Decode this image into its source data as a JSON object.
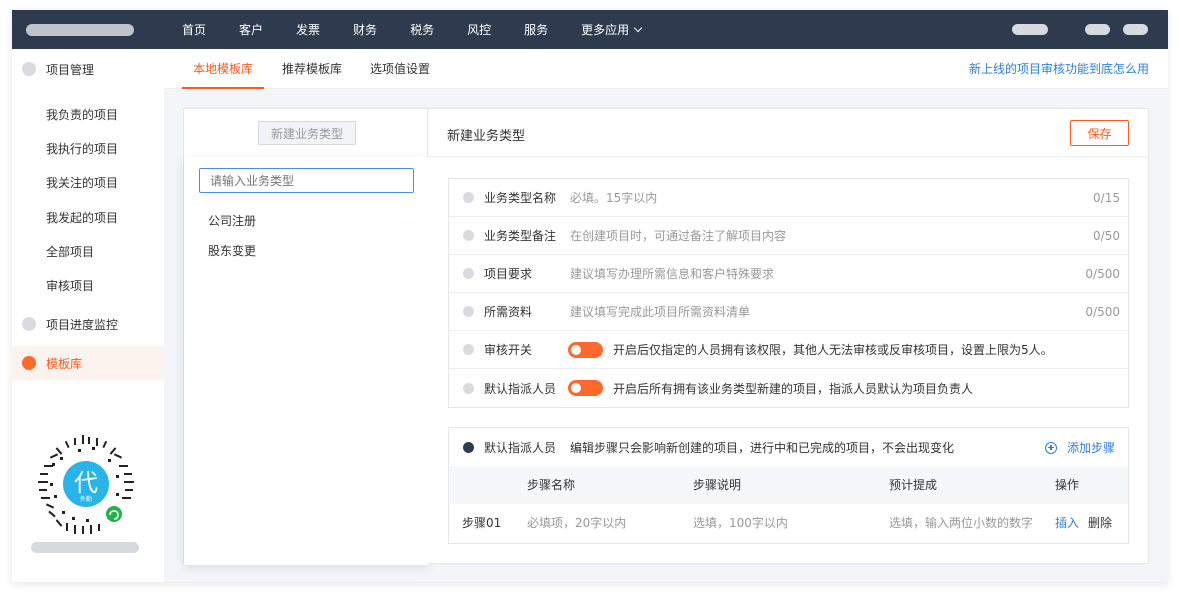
{
  "topbar": {
    "nav": [
      "首页",
      "客户",
      "发票",
      "财务",
      "税务",
      "风控",
      "服务"
    ],
    "more_label": "更多应用"
  },
  "sidebar": {
    "groups": [
      {
        "label": "项目管理",
        "active": false
      },
      {
        "label": "项目进度监控",
        "active": false
      },
      {
        "label": "模板库",
        "active": true
      }
    ],
    "sub_items": [
      "我负责的项目",
      "我执行的项目",
      "我关注的项目",
      "我发起的项目",
      "全部项目",
      "审核项目"
    ],
    "qr_center_text": "代",
    "qr_sub_text": "外勤"
  },
  "tabs": {
    "items": [
      "本地模板库",
      "推荐模板库",
      "选项值设置"
    ],
    "active_index": 0,
    "help_link": "新上线的项目审核功能到底怎么用"
  },
  "left_panel": {
    "new_button": "新建业务类型",
    "input_placeholder": "请输入业务类型",
    "types": [
      "公司注册",
      "股东变更"
    ]
  },
  "right_panel": {
    "title": "新建业务类型",
    "save_label": "保存",
    "fields": [
      {
        "label": "业务类型名称",
        "placeholder": "必填。15字以内",
        "count": "0/15"
      },
      {
        "label": "业务类型备注",
        "placeholder": "在创建项目时，可通过备注了解项目内容",
        "count": "0/50"
      },
      {
        "label": "项目要求",
        "placeholder": "建议填写办理所需信息和客户特殊要求",
        "count": "0/500"
      },
      {
        "label": "所需资料",
        "placeholder": "建议填写完成此项目所需资料清单",
        "count": "0/500"
      }
    ],
    "toggles": [
      {
        "label": "审核开关",
        "on": true,
        "desc": "开启后仅指定的人员拥有该权限，其他人无法审核或反审核项目，设置上限为5人。"
      },
      {
        "label": "默认指派人员",
        "on": true,
        "desc": "开启后所有拥有该业务类型新建的项目，指派人员默认为项目负责人"
      }
    ],
    "steps": {
      "label": "默认指派人员",
      "note": "编辑步骤只会影响新创建的项目，进行中和已完成的项目，不会出现变化",
      "add_label": "添加步骤",
      "columns": [
        "步骤名称",
        "步骤说明",
        "预计提成",
        "操作"
      ],
      "rows": [
        {
          "step": "步骤01",
          "name": "必填项，20字以内",
          "desc": "选填，100字以内",
          "commission": "选填，输入两位小数的数字",
          "insert": "插入",
          "delete": "删除"
        }
      ]
    }
  },
  "colors": {
    "accent": "#ff5a1f",
    "topbar": "#2e3a4d",
    "link": "#2f7fd6"
  }
}
